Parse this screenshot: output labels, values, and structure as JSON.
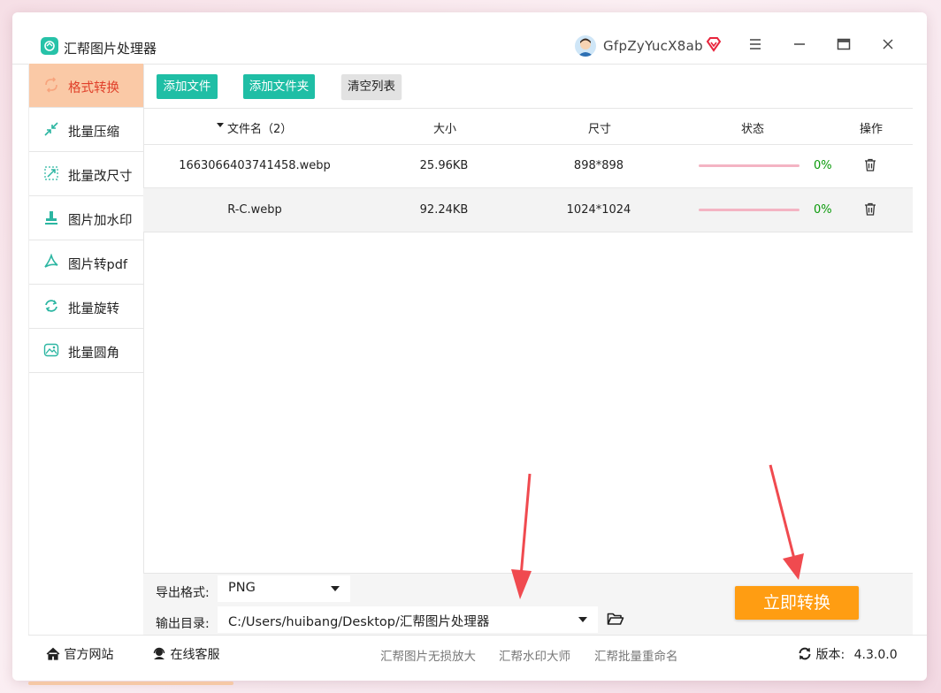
{
  "app": {
    "title": "汇帮图片处理器",
    "username": "GfpZyYucX8ab"
  },
  "window_buttons": {
    "menu": "≡",
    "minimize": "—",
    "maximize": "▭",
    "close": "✕"
  },
  "sidebar": {
    "items": [
      {
        "label": "格式转换",
        "icon": "format-convert-icon",
        "active": true
      },
      {
        "label": "批量压缩",
        "icon": "compress-icon"
      },
      {
        "label": "批量改尺寸",
        "icon": "resize-icon"
      },
      {
        "label": "图片加水印",
        "icon": "watermark-icon"
      },
      {
        "label": "图片转pdf",
        "icon": "pdf-icon"
      },
      {
        "label": "批量旋转",
        "icon": "rotate-icon"
      },
      {
        "label": "批量圆角",
        "icon": "rounded-corner-icon"
      }
    ]
  },
  "toolbar": {
    "add_file": "添加文件",
    "add_folder": "添加文件夹",
    "clear_list": "清空列表"
  },
  "table": {
    "headers": {
      "filename": "文件名（2）",
      "size": "大小",
      "dimensions": "尺寸",
      "status": "状态",
      "actions": "操作"
    },
    "rows": [
      {
        "filename": "1663066403741458.webp",
        "size": "25.96KB",
        "dimensions": "898*898",
        "progress": "0%"
      },
      {
        "filename": "R-C.webp",
        "size": "92.24KB",
        "dimensions": "1024*1024",
        "progress": "0%"
      }
    ]
  },
  "options": {
    "format_label": "导出格式:",
    "format_value": "PNG",
    "output_label": "输出目录:",
    "output_value": "C:/Users/huibang/Desktop/汇帮图片处理器"
  },
  "convert_button": "立即转换",
  "footer": {
    "website": "官方网站",
    "support": "在线客服",
    "links": [
      "汇帮图片无损放大",
      "汇帮水印大师",
      "汇帮批量重命名"
    ],
    "version_label": "版本:",
    "version_value": "4.3.0.0"
  },
  "colors": {
    "accent": "#1fbea5",
    "active_tab": "#fac9a6",
    "convert": "#ff9d12",
    "arrow": "#f04a4f"
  }
}
